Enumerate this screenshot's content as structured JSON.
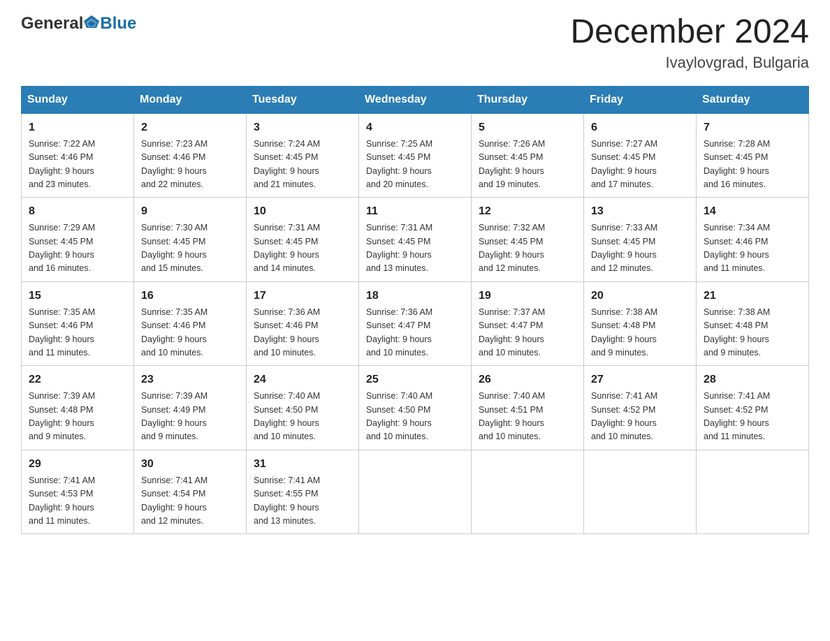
{
  "header": {
    "logo_general": "General",
    "logo_blue": "Blue",
    "title": "December 2024",
    "subtitle": "Ivaylovgrad, Bulgaria"
  },
  "days_of_week": [
    "Sunday",
    "Monday",
    "Tuesday",
    "Wednesday",
    "Thursday",
    "Friday",
    "Saturday"
  ],
  "weeks": [
    [
      {
        "day": "1",
        "sunrise": "7:22 AM",
        "sunset": "4:46 PM",
        "daylight": "9 hours and 23 minutes."
      },
      {
        "day": "2",
        "sunrise": "7:23 AM",
        "sunset": "4:46 PM",
        "daylight": "9 hours and 22 minutes."
      },
      {
        "day": "3",
        "sunrise": "7:24 AM",
        "sunset": "4:45 PM",
        "daylight": "9 hours and 21 minutes."
      },
      {
        "day": "4",
        "sunrise": "7:25 AM",
        "sunset": "4:45 PM",
        "daylight": "9 hours and 20 minutes."
      },
      {
        "day": "5",
        "sunrise": "7:26 AM",
        "sunset": "4:45 PM",
        "daylight": "9 hours and 19 minutes."
      },
      {
        "day": "6",
        "sunrise": "7:27 AM",
        "sunset": "4:45 PM",
        "daylight": "9 hours and 17 minutes."
      },
      {
        "day": "7",
        "sunrise": "7:28 AM",
        "sunset": "4:45 PM",
        "daylight": "9 hours and 16 minutes."
      }
    ],
    [
      {
        "day": "8",
        "sunrise": "7:29 AM",
        "sunset": "4:45 PM",
        "daylight": "9 hours and 16 minutes."
      },
      {
        "day": "9",
        "sunrise": "7:30 AM",
        "sunset": "4:45 PM",
        "daylight": "9 hours and 15 minutes."
      },
      {
        "day": "10",
        "sunrise": "7:31 AM",
        "sunset": "4:45 PM",
        "daylight": "9 hours and 14 minutes."
      },
      {
        "day": "11",
        "sunrise": "7:31 AM",
        "sunset": "4:45 PM",
        "daylight": "9 hours and 13 minutes."
      },
      {
        "day": "12",
        "sunrise": "7:32 AM",
        "sunset": "4:45 PM",
        "daylight": "9 hours and 12 minutes."
      },
      {
        "day": "13",
        "sunrise": "7:33 AM",
        "sunset": "4:45 PM",
        "daylight": "9 hours and 12 minutes."
      },
      {
        "day": "14",
        "sunrise": "7:34 AM",
        "sunset": "4:46 PM",
        "daylight": "9 hours and 11 minutes."
      }
    ],
    [
      {
        "day": "15",
        "sunrise": "7:35 AM",
        "sunset": "4:46 PM",
        "daylight": "9 hours and 11 minutes."
      },
      {
        "day": "16",
        "sunrise": "7:35 AM",
        "sunset": "4:46 PM",
        "daylight": "9 hours and 10 minutes."
      },
      {
        "day": "17",
        "sunrise": "7:36 AM",
        "sunset": "4:46 PM",
        "daylight": "9 hours and 10 minutes."
      },
      {
        "day": "18",
        "sunrise": "7:36 AM",
        "sunset": "4:47 PM",
        "daylight": "9 hours and 10 minutes."
      },
      {
        "day": "19",
        "sunrise": "7:37 AM",
        "sunset": "4:47 PM",
        "daylight": "9 hours and 10 minutes."
      },
      {
        "day": "20",
        "sunrise": "7:38 AM",
        "sunset": "4:48 PM",
        "daylight": "9 hours and 9 minutes."
      },
      {
        "day": "21",
        "sunrise": "7:38 AM",
        "sunset": "4:48 PM",
        "daylight": "9 hours and 9 minutes."
      }
    ],
    [
      {
        "day": "22",
        "sunrise": "7:39 AM",
        "sunset": "4:48 PM",
        "daylight": "9 hours and 9 minutes."
      },
      {
        "day": "23",
        "sunrise": "7:39 AM",
        "sunset": "4:49 PM",
        "daylight": "9 hours and 9 minutes."
      },
      {
        "day": "24",
        "sunrise": "7:40 AM",
        "sunset": "4:50 PM",
        "daylight": "9 hours and 10 minutes."
      },
      {
        "day": "25",
        "sunrise": "7:40 AM",
        "sunset": "4:50 PM",
        "daylight": "9 hours and 10 minutes."
      },
      {
        "day": "26",
        "sunrise": "7:40 AM",
        "sunset": "4:51 PM",
        "daylight": "9 hours and 10 minutes."
      },
      {
        "day": "27",
        "sunrise": "7:41 AM",
        "sunset": "4:52 PM",
        "daylight": "9 hours and 10 minutes."
      },
      {
        "day": "28",
        "sunrise": "7:41 AM",
        "sunset": "4:52 PM",
        "daylight": "9 hours and 11 minutes."
      }
    ],
    [
      {
        "day": "29",
        "sunrise": "7:41 AM",
        "sunset": "4:53 PM",
        "daylight": "9 hours and 11 minutes."
      },
      {
        "day": "30",
        "sunrise": "7:41 AM",
        "sunset": "4:54 PM",
        "daylight": "9 hours and 12 minutes."
      },
      {
        "day": "31",
        "sunrise": "7:41 AM",
        "sunset": "4:55 PM",
        "daylight": "9 hours and 13 minutes."
      },
      null,
      null,
      null,
      null
    ]
  ],
  "labels": {
    "sunrise": "Sunrise:",
    "sunset": "Sunset:",
    "daylight": "Daylight:"
  }
}
